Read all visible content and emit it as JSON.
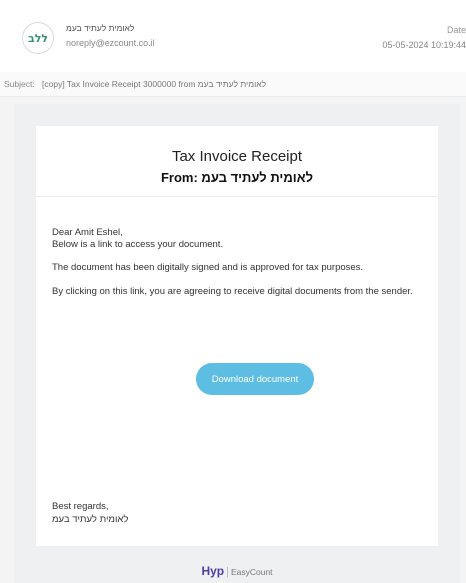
{
  "header": {
    "avatar_text": "ללב",
    "sender_name": "לאומית לעתיד בעמ",
    "sender_email": "noreply@ezcount.co.il",
    "date_label": "Date",
    "date_value": "05-05-2024 10:19:44"
  },
  "subject": {
    "label": "Subject:",
    "text": "[copy] Tax Invoice Receipt 3000000 from לאומית לעתיד בעמ"
  },
  "email": {
    "title": "Tax Invoice Receipt",
    "from_line": "From: לאומית לעתיד בעמ",
    "greeting": "Dear Amit Eshel,",
    "line1": "Below is a link to access your document.",
    "line2": "The document has been digitally signed and is approved for tax purposes.",
    "line3": "By clicking on this link, you are agreeing to receive digital documents from the sender.",
    "button_label": "Download document",
    "regards": "Best regards,",
    "signature": "לאומית לעתיד בעמ"
  },
  "footer": {
    "hyp": "Hyp",
    "sep": "|",
    "brand": "EasyCount"
  },
  "colors": {
    "button": "#5dbde3",
    "hyp_brand": "#4b3fa8"
  }
}
